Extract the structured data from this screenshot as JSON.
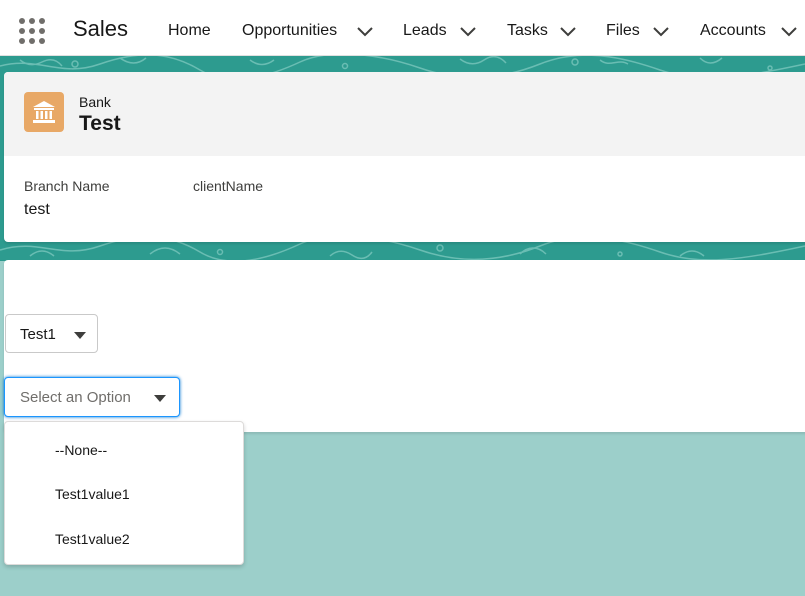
{
  "app": {
    "name": "Sales"
  },
  "icons": {
    "launcher": "app-launcher-icon",
    "record": "bank-icon",
    "chevron": "chevron-down-icon"
  },
  "nav": {
    "home": "Home",
    "opportunities": "Opportunities",
    "leads": "Leads",
    "tasks": "Tasks",
    "files": "Files",
    "accounts": "Accounts"
  },
  "record": {
    "type": "Bank",
    "title": "Test",
    "fields": {
      "branch_name_label": "Branch Name",
      "branch_name_value": "test",
      "client_name_label": "clientName"
    }
  },
  "form": {
    "select1_value": "Test1",
    "select2_placeholder": "Select an Option",
    "options": [
      "--None--",
      "Test1value1",
      "Test1value2"
    ]
  },
  "colors": {
    "banner": "#2d9b8f",
    "page_bg": "#9ccfca",
    "record_icon": "#e8a866",
    "focus_border": "#1b96ff"
  }
}
